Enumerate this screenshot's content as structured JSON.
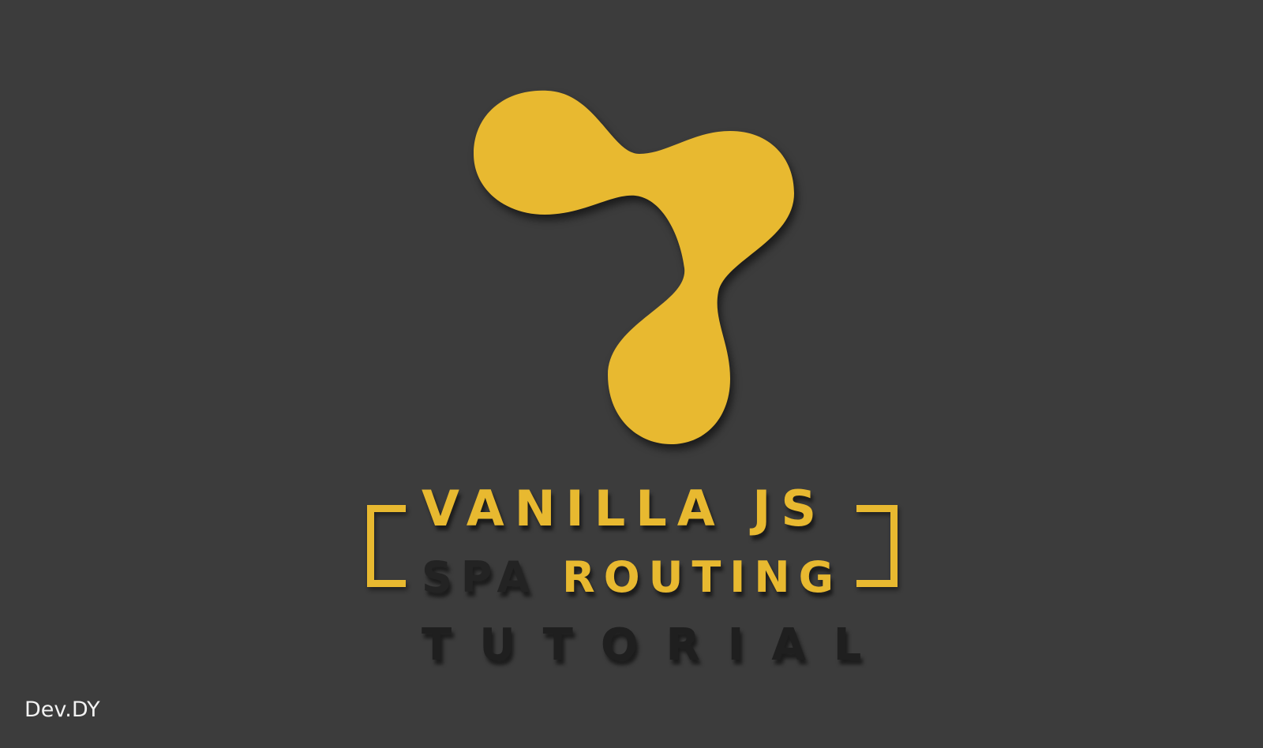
{
  "background_color": "#3c3c3c",
  "accent_color": "#e8b930",
  "dark_text_color": "#232323",
  "logo": {
    "icon": "tri-blob-logo-icon"
  },
  "title": {
    "line1": "VANILLA JS",
    "line2_part1": "SPA",
    "line2_part2": "ROUTING",
    "line3": "TUTORIAL"
  },
  "credit": "Dev.DY"
}
